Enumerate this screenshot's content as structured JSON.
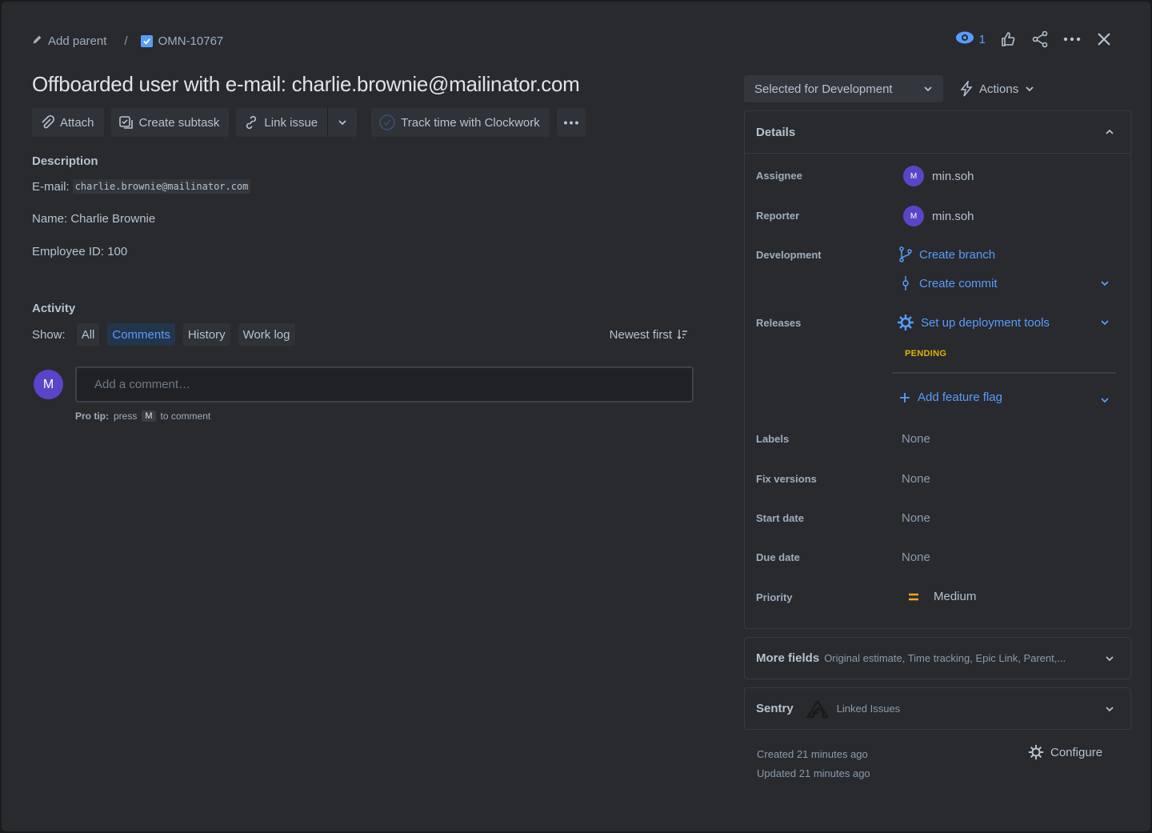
{
  "header": {
    "add_parent": "Add parent",
    "separator": "/",
    "issue_key": "OMN-10767",
    "watch_count": "1"
  },
  "title": "Offboarded user with e-mail: charlie.brownie@mailinator.com",
  "toolbar": {
    "attach": "Attach",
    "create_subtask": "Create subtask",
    "link_issue": "Link issue",
    "track_time": "Track time with Clockwork"
  },
  "description": {
    "heading": "Description",
    "email_label": "E-mail:",
    "email_value": "charlie.brownie@mailinator.com",
    "name_line": "Name: Charlie Brownie",
    "employee_line": "Employee ID: 100"
  },
  "activity": {
    "heading": "Activity",
    "show_label": "Show:",
    "filters": [
      "All",
      "Comments",
      "History",
      "Work log"
    ],
    "selected_filter": "Comments",
    "sort_label": "Newest first",
    "avatar_initial": "M",
    "comment_placeholder": "Add a comment…",
    "protip_bold": "Pro tip:",
    "protip_press": "press",
    "protip_key": "M",
    "protip_tail": "to comment"
  },
  "sidebar": {
    "status": "Selected for Development",
    "actions": "Actions",
    "details_title": "Details",
    "fields": {
      "assignee_label": "Assignee",
      "assignee_initial": "M",
      "assignee": "min.soh",
      "reporter_label": "Reporter",
      "reporter_initial": "M",
      "reporter": "min.soh",
      "development_label": "Development",
      "create_branch": "Create branch",
      "create_commit": "Create commit",
      "releases_label": "Releases",
      "setup_deployment": "Set up deployment tools",
      "pending": "PENDING",
      "add_feature_flag": "Add feature flag",
      "labels_label": "Labels",
      "labels": "None",
      "fix_versions_label": "Fix versions",
      "fix_versions": "None",
      "start_date_label": "Start date",
      "start_date": "None",
      "due_date_label": "Due date",
      "due_date": "None",
      "priority_label": "Priority",
      "priority": "Medium"
    },
    "more_fields_title": "More fields",
    "more_fields_hint": "Original estimate, Time tracking, Epic Link, Parent,...",
    "sentry_title": "Sentry",
    "sentry_hint": "Linked Issues",
    "created": "Created 21 minutes ago",
    "updated": "Updated 21 minutes ago",
    "configure": "Configure"
  },
  "colors": {
    "accent": "#579dff",
    "avatar": "#5a45c9",
    "pending": "#e2b203",
    "priority_medium": "#f5a623"
  }
}
